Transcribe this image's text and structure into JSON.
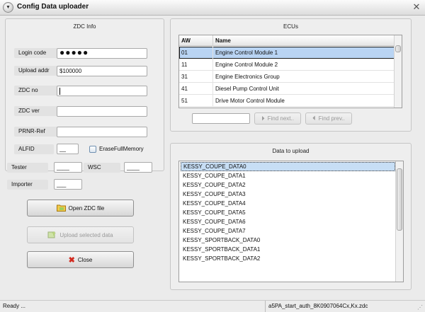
{
  "window": {
    "title": "Config Data uploader"
  },
  "zdc_info": {
    "title": "ZDC Info",
    "login_label": "Login code",
    "login_value": "●●●●●",
    "upload_label": "Upload addr",
    "upload_value": "$100000",
    "zdc_no_label": "ZDC no",
    "zdc_ver_label": "ZDC ver",
    "prnr_label": "PRNR-Ref",
    "alfid_label": "ALFID",
    "alfid_value": "__",
    "erase_label": "EraseFullMemory"
  },
  "fields": {
    "tester_label": "Tester",
    "tester_value": "____",
    "wsc_label": "WSC",
    "wsc_value": "____",
    "importer_label": "Importer",
    "importer_value": "___"
  },
  "buttons": {
    "open_zdc": "Open ZDC file",
    "upload_selected": "Upload selected data",
    "close": "Close"
  },
  "ecus": {
    "title": "ECUs",
    "columns": [
      "AW",
      "Name"
    ],
    "rows": [
      [
        "01",
        "Engine Control Module 1"
      ],
      [
        "11",
        "Engine Control Module 2"
      ],
      [
        "31",
        "Engine Electronics Group"
      ],
      [
        "41",
        "Diesel Pump Control Unit"
      ],
      [
        "51",
        "Drive Motor Control Module"
      ]
    ],
    "find_next": "Find next..",
    "find_prev": "Find prev.."
  },
  "data_upload": {
    "title": "Data to upload",
    "items": [
      "KESSY_COUPE_DATA0",
      "KESSY_COUPE_DATA1",
      "KESSY_COUPE_DATA2",
      "KESSY_COUPE_DATA3",
      "KESSY_COUPE_DATA4",
      "KESSY_COUPE_DATA5",
      "KESSY_COUPE_DATA6",
      "KESSY_COUPE_DATA7",
      "KESSY_SPORTBACK_DATA0",
      "KESSY_SPORTBACK_DATA1",
      "KESSY_SPORTBACK_DATA2"
    ]
  },
  "status": {
    "left": "Ready ...",
    "right": "a5PA_start_auth_8K0907064Cx,Kx.zdc"
  },
  "colors": {
    "selection": "#b9d4f3",
    "close_icon": "#d22a1f"
  }
}
